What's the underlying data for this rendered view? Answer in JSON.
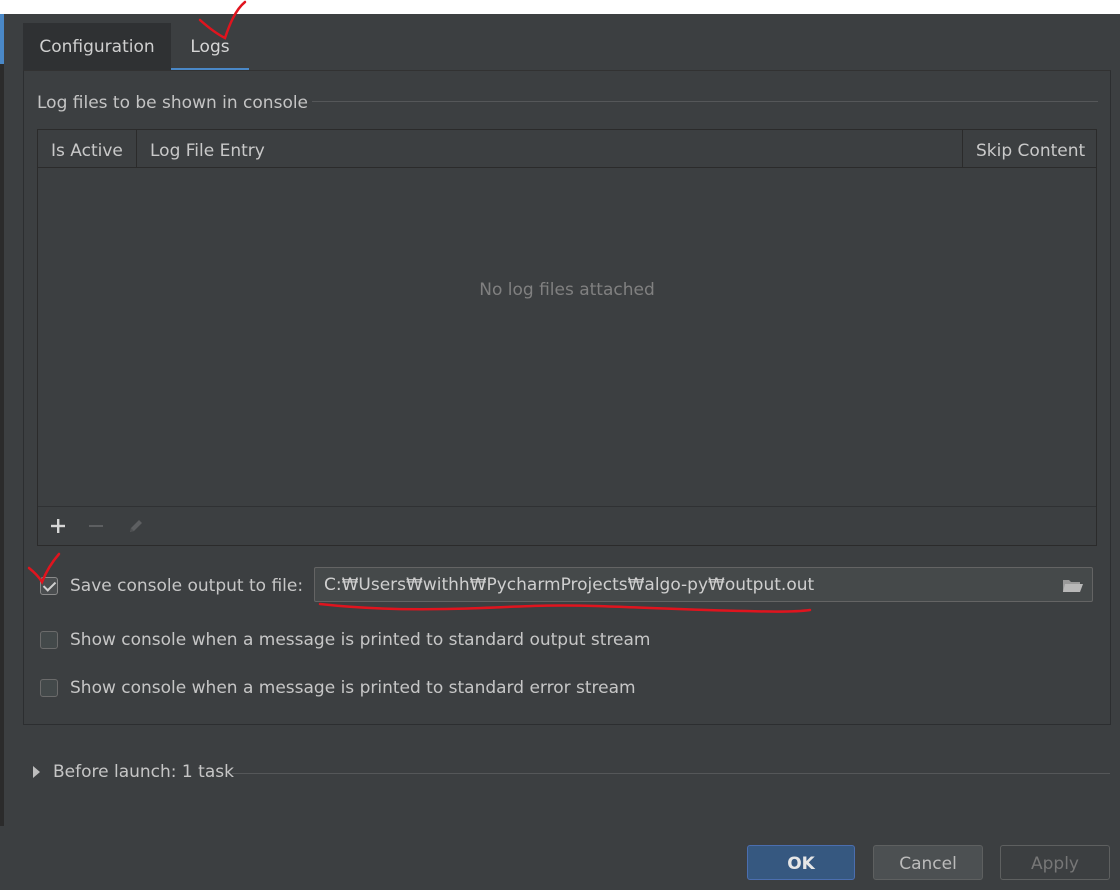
{
  "tabs": {
    "configuration": "Configuration",
    "logs": "Logs"
  },
  "log_group": {
    "title": "Log files to be shown in console",
    "columns": [
      "Is Active",
      "Log File Entry",
      "Skip Content"
    ],
    "empty_text": "No log files attached"
  },
  "toolbar": {
    "add_icon": "plus-icon",
    "remove_icon": "minus-icon",
    "edit_icon": "pencil-icon"
  },
  "save_output": {
    "label": "Save console output to file:",
    "checked": true,
    "path": "C:₩Users₩withh₩PycharmProjects₩algo-py₩output.out",
    "browse_icon": "folder-icon"
  },
  "show_stdout": {
    "label": "Show console when a message is printed to standard output stream",
    "checked": false
  },
  "show_stderr": {
    "label": "Show console when a message is printed to standard error stream",
    "checked": false
  },
  "before_launch": {
    "label": "Before launch: 1 task"
  },
  "buttons": {
    "ok": "OK",
    "cancel": "Cancel",
    "apply": "Apply"
  },
  "colors": {
    "accent": "#4a88c7",
    "background": "#3c3f41",
    "annotation": "#e0141e"
  }
}
